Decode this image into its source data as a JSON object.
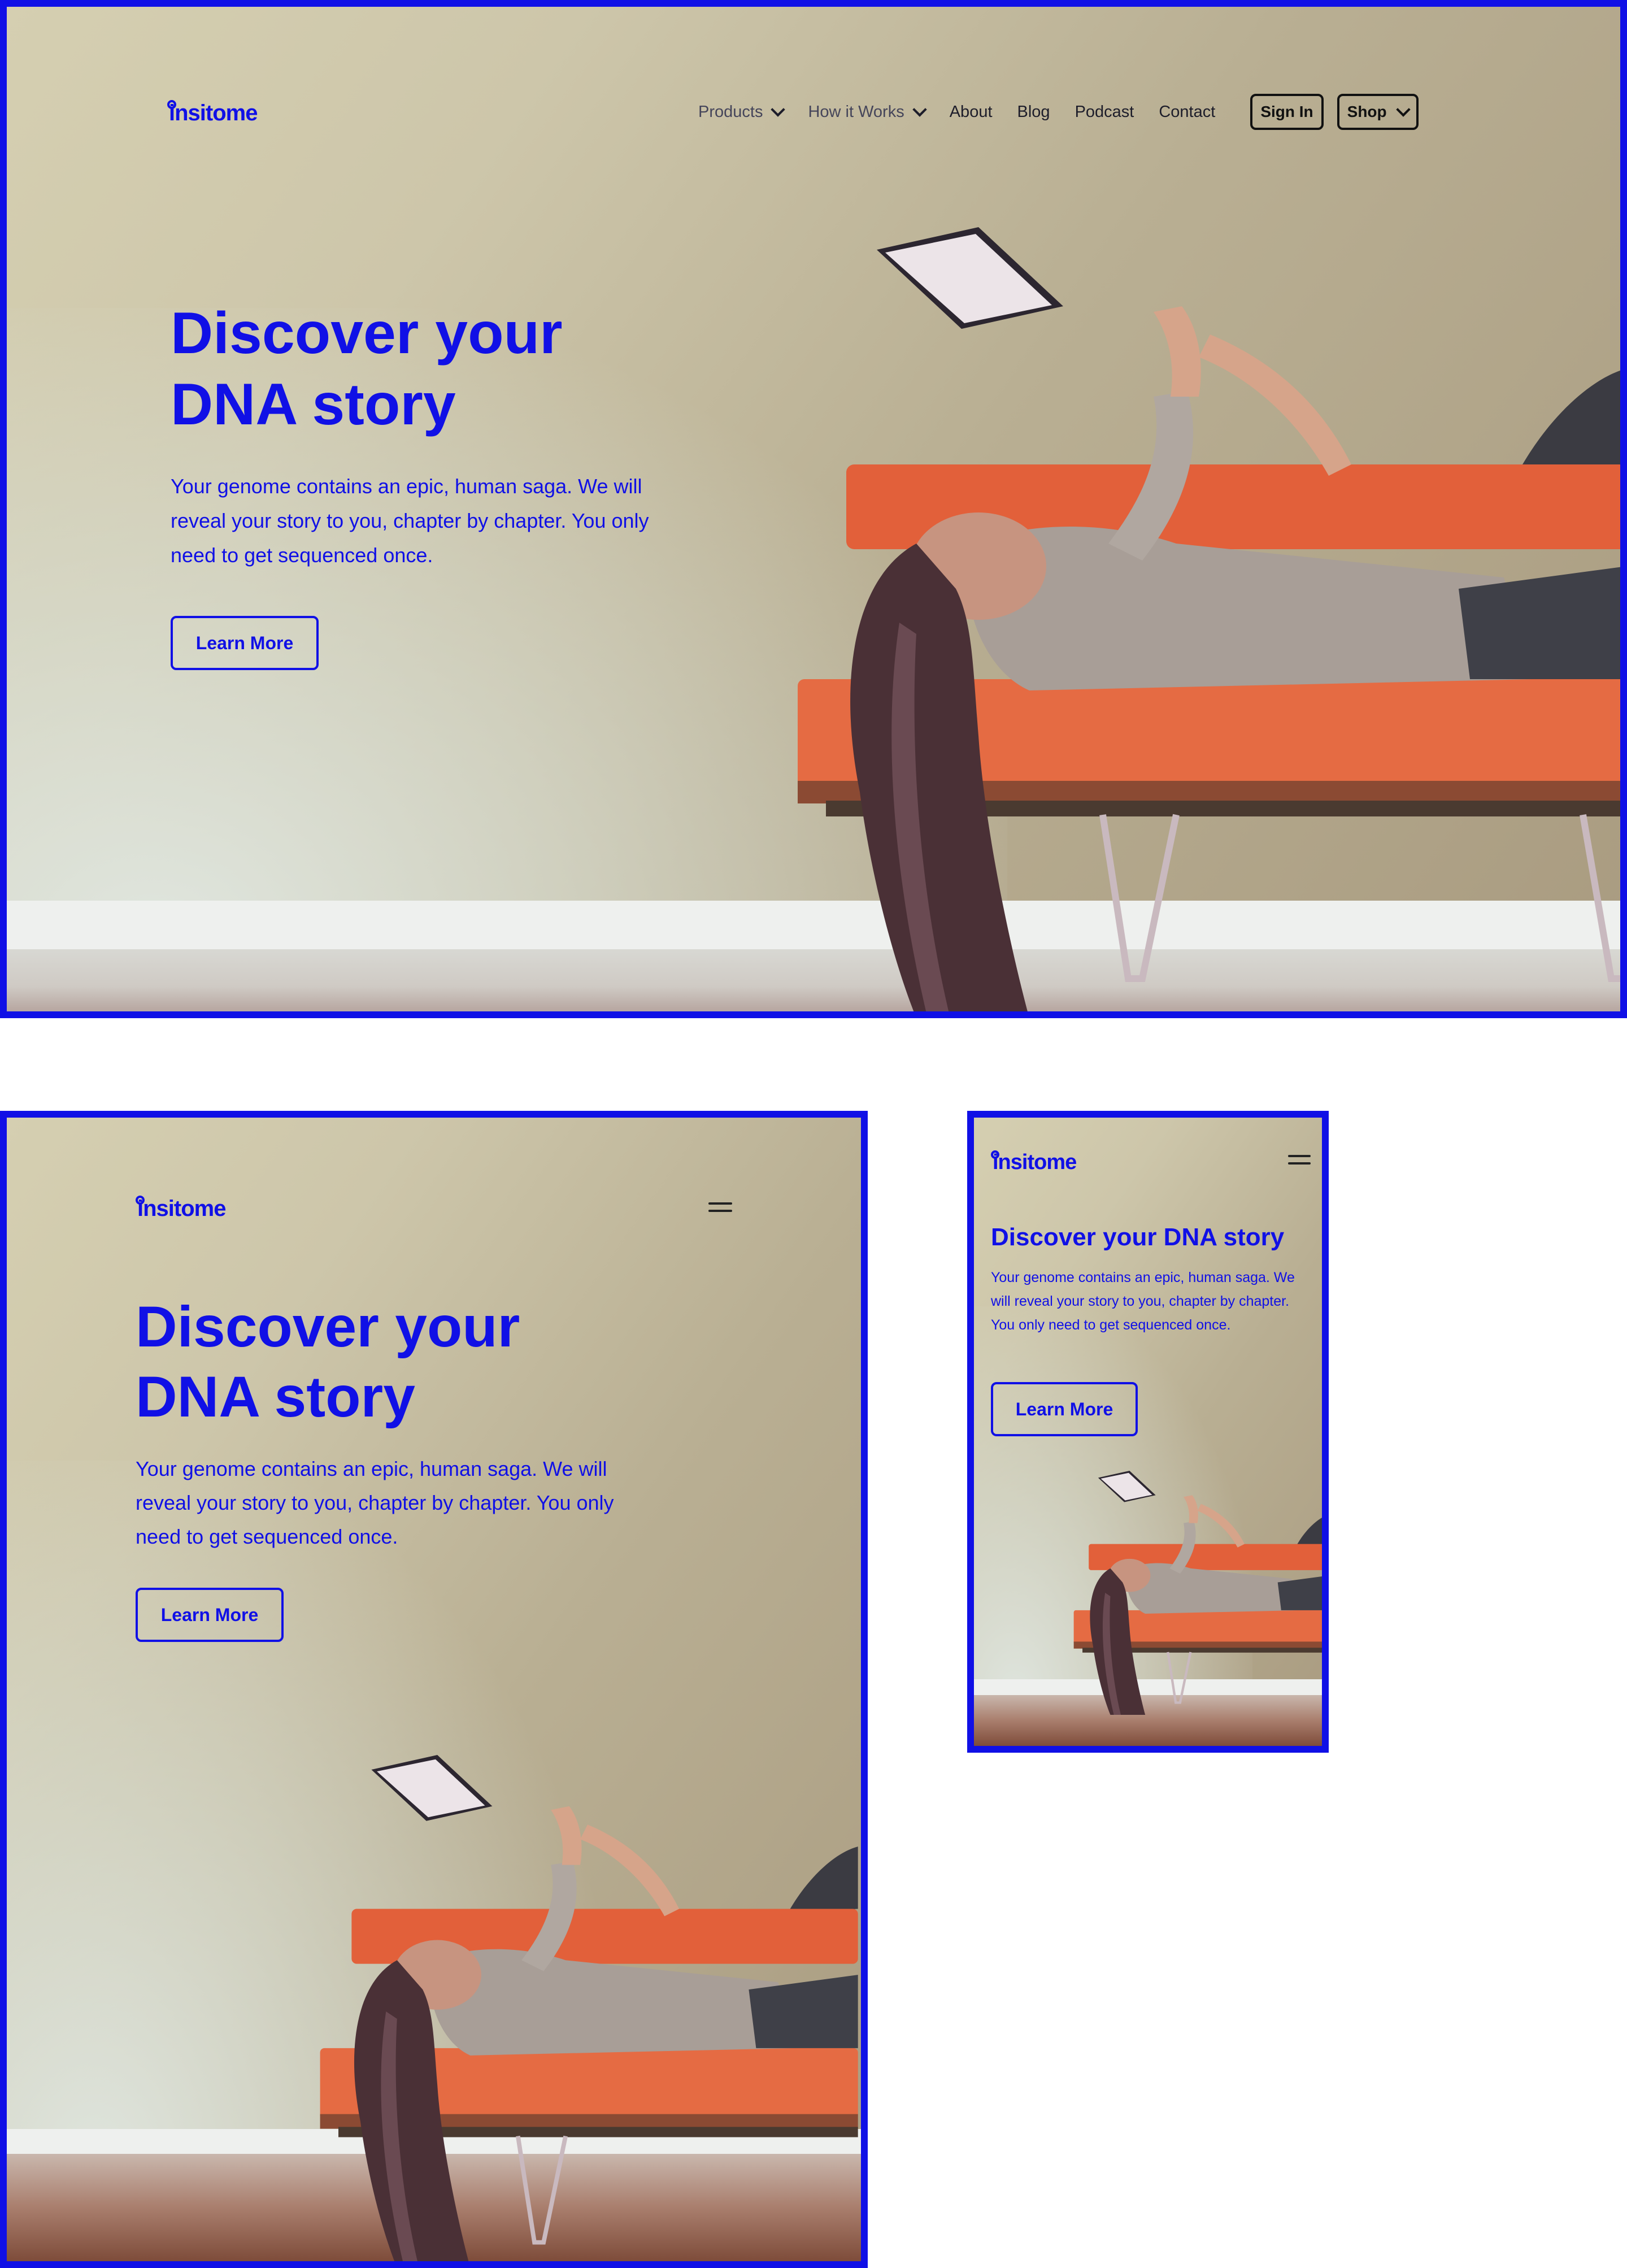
{
  "brand": {
    "logo_text": "insitome",
    "accent_color": "#1010e6"
  },
  "hero": {
    "title_line1": "Discover your",
    "title_line2": "DNA story",
    "title_mobile": "Discover your DNA story",
    "description": "Your genome contains an epic, human saga. We will reveal your story to you, chapter by chapter. You only need to get sequenced once.",
    "cta_label": "Learn More"
  },
  "nav": {
    "items": [
      {
        "label": "Products",
        "icon": "chevron-down-icon"
      },
      {
        "label": "How it Works",
        "icon": "chevron-down-icon"
      },
      {
        "label": "About"
      },
      {
        "label": "Blog"
      },
      {
        "label": "Podcast"
      },
      {
        "label": "Contact"
      }
    ],
    "sign_in_label": "Sign In",
    "shop_label": "Shop",
    "menu_icon": "hamburger-menu-icon"
  },
  "photo": {
    "subject": "woman lying on an orange sofa looking at a tablet",
    "sofa_color": "#e2603a"
  }
}
